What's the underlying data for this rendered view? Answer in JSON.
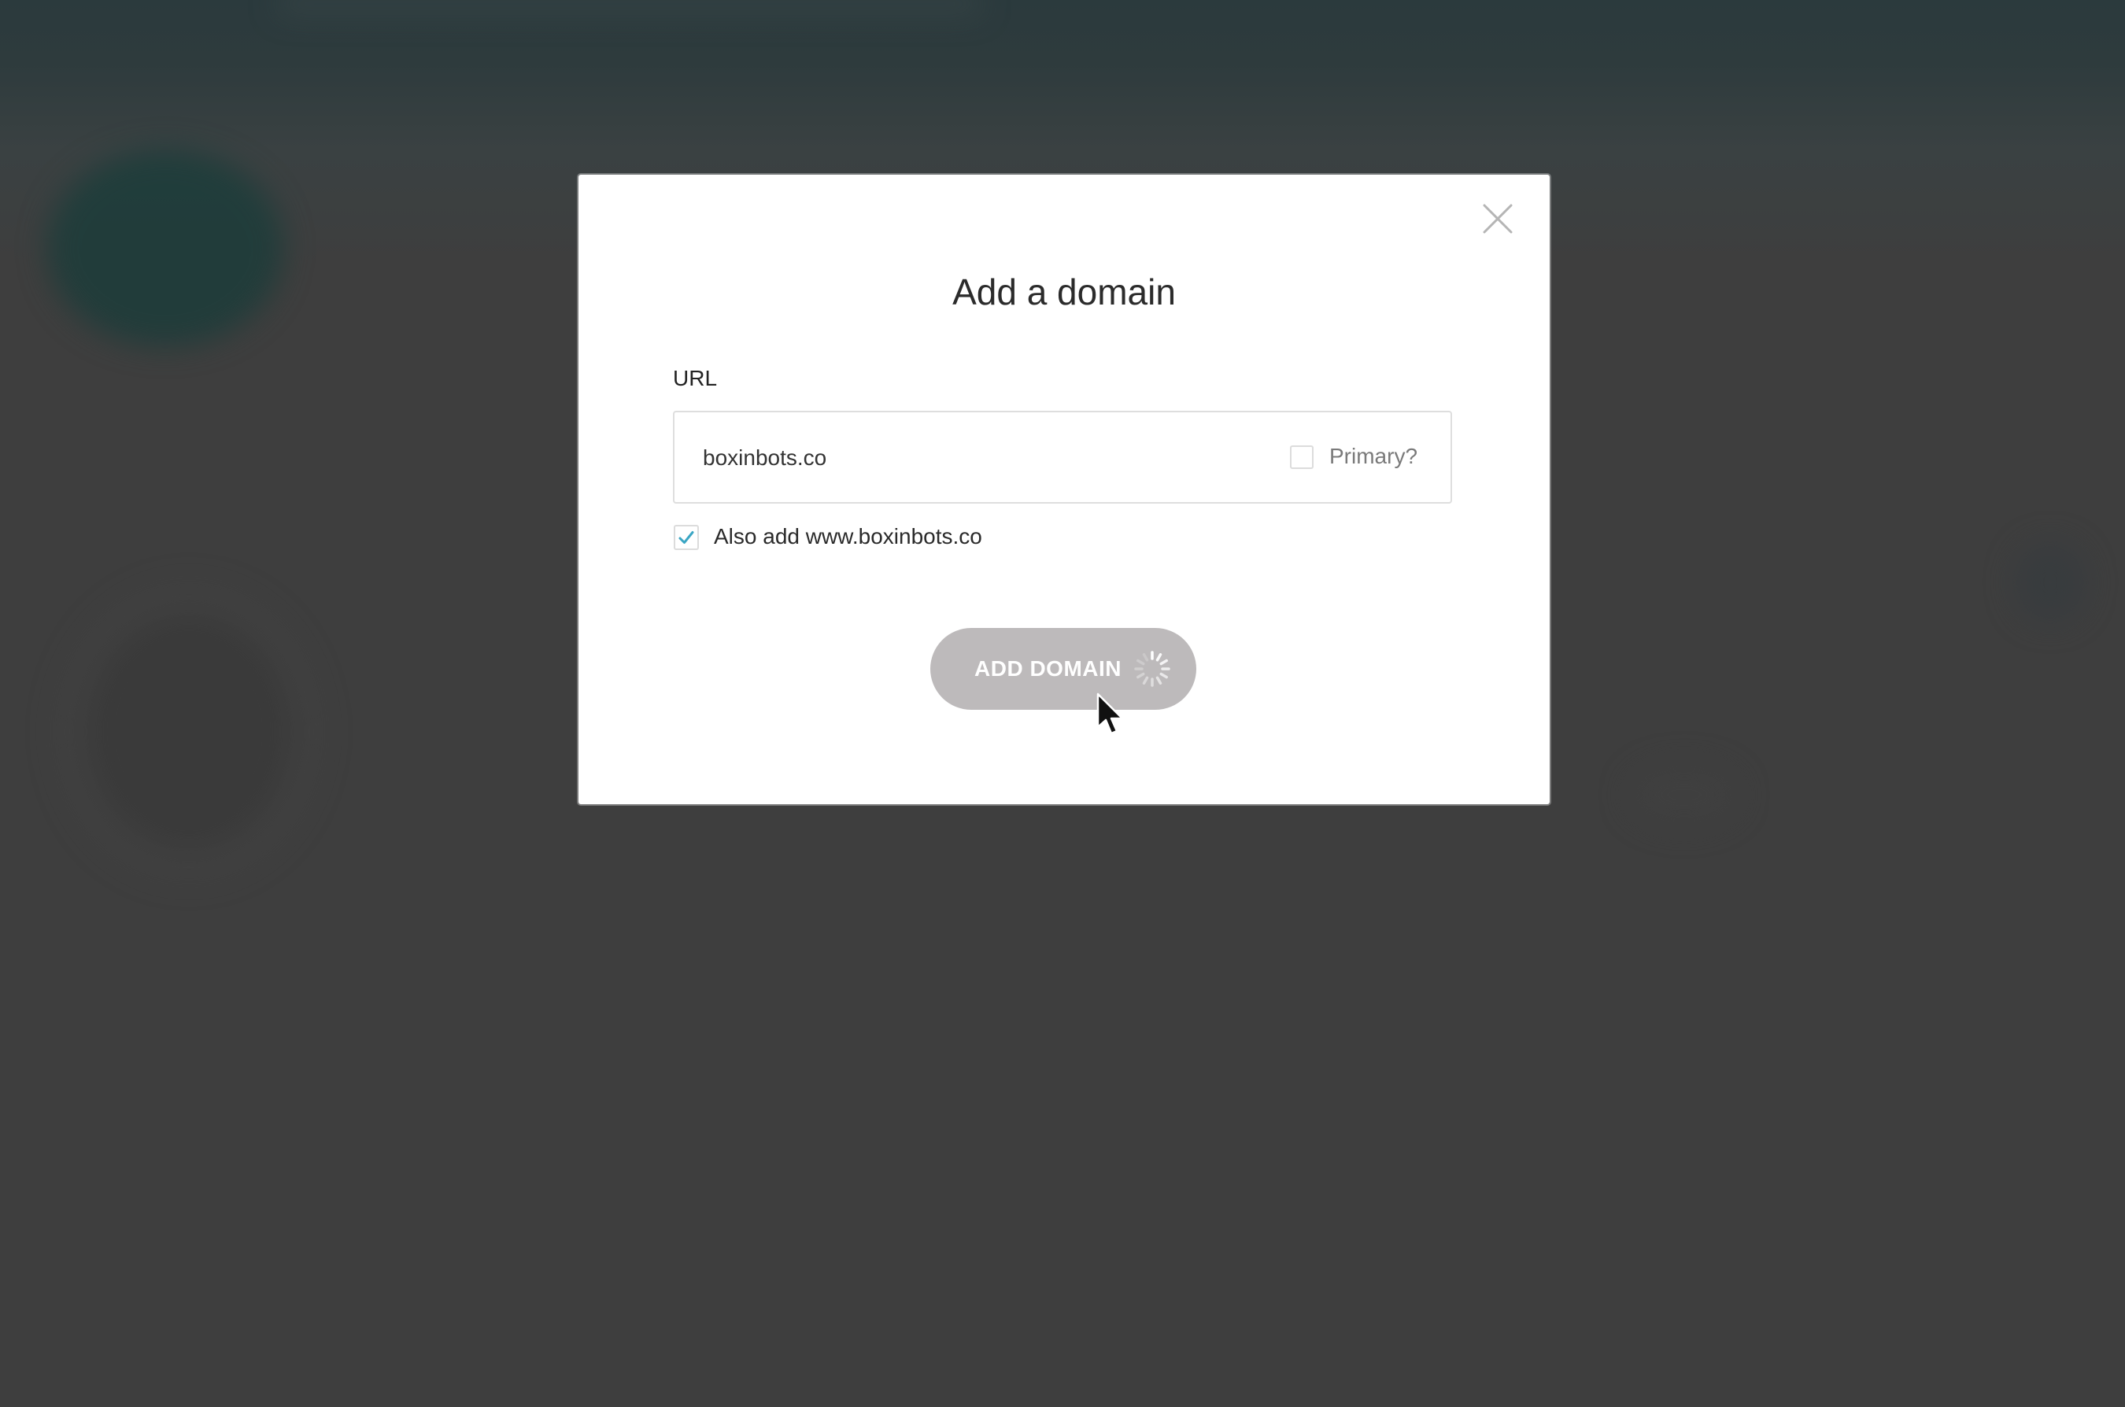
{
  "dialog": {
    "title": "Add a domain",
    "close_icon": "close-icon",
    "url_label": "URL",
    "url_value": "boxinbots.co",
    "primary_label": "Primary?",
    "primary_checked": false,
    "also_add_label": "Also add www.boxinbots.co",
    "also_add_checked": true,
    "submit_label": "ADD DOMAIN",
    "submit_state": "loading"
  },
  "colors": {
    "overlay_background": "#3e3e3e",
    "modal_background": "#ffffff",
    "button_background": "#bdbabb",
    "checkmark": "#3aa6c4"
  }
}
